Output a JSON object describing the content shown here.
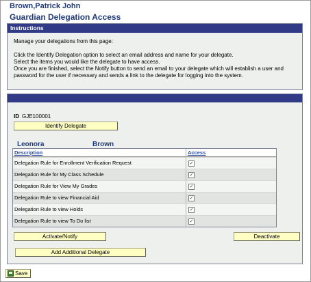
{
  "header": {
    "person_name": "Brown,Patrick John",
    "page_title": "Guardian Delegation Access"
  },
  "instructions": {
    "heading": "Instructions",
    "line1": "Manage your delegations from this page:",
    "line2": "Click the Identify Delegation option to select an email address and name for your delegate.",
    "line3": "Select the items you would like the delegate to have access.",
    "line4": "Once you are finished, select the Notify button to send an email to your delegate which will establish a user and",
    "line5": "password for the user if necessary and sends a link to the delegate for logging into the system."
  },
  "delegation": {
    "id_label": "ID",
    "id_value": "GJE100001",
    "identify_button": "Identify Delegate",
    "delegate_first": "Leonora",
    "delegate_last": "Brown",
    "columns": {
      "description": "Description",
      "access": "Access"
    },
    "rows": [
      {
        "description": "Delegation Rule for Enrollment Verification Request",
        "access": true
      },
      {
        "description": "Delegation Rule for My Class Schedule",
        "access": true
      },
      {
        "description": "Delegation Rule for View My Grades",
        "access": true
      },
      {
        "description": "Delegation Rule to view Financial Aid",
        "access": true
      },
      {
        "description": "Delegation Rule to view Holds",
        "access": true
      },
      {
        "description": "Delegation Rule to view To Do list",
        "access": true
      }
    ],
    "activate_button": "Activate/Notify",
    "deactivate_button": "Deactivate"
  },
  "add_delegate_button": "Add Additional Delegate",
  "save_button": "Save",
  "colors": {
    "title": "#1f3a7a",
    "panel_header": "#303a86",
    "button_bg": "#ffffc4"
  }
}
